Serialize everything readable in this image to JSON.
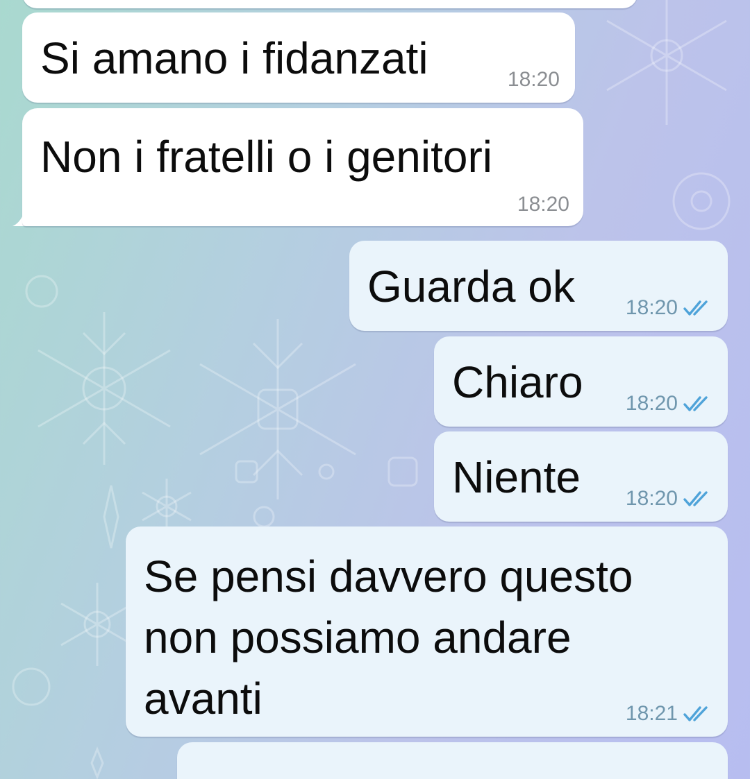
{
  "chat": {
    "messages": [
      {
        "id": "m0",
        "direction": "incoming",
        "text": "",
        "time": ""
      },
      {
        "id": "m1",
        "direction": "incoming",
        "text": "Si amano i fidanzati",
        "time": "18:20"
      },
      {
        "id": "m2",
        "direction": "incoming",
        "text": "Non i fratelli o i genitori",
        "time": "18:20"
      },
      {
        "id": "m3",
        "direction": "outgoing",
        "text": "Guarda ok",
        "time": "18:20",
        "status": "read"
      },
      {
        "id": "m4",
        "direction": "outgoing",
        "text": "Chiaro",
        "time": "18:20",
        "status": "read"
      },
      {
        "id": "m5",
        "direction": "outgoing",
        "text": "Niente",
        "time": "18:20",
        "status": "read"
      },
      {
        "id": "m6",
        "direction": "outgoing",
        "lines": [
          "Se pensi davvero questo",
          "non possiamo andare",
          "avanti"
        ],
        "time": "18:21",
        "status": "read"
      },
      {
        "id": "m7",
        "direction": "outgoing",
        "text": "",
        "time": ""
      }
    ]
  },
  "colors": {
    "incoming_bubble": "#ffffff",
    "outgoing_bubble": "#eaf4fb",
    "read_check": "#4fa3d9",
    "text": "#0c0c0c"
  },
  "icons": {
    "read_status": "double-check-icon"
  }
}
